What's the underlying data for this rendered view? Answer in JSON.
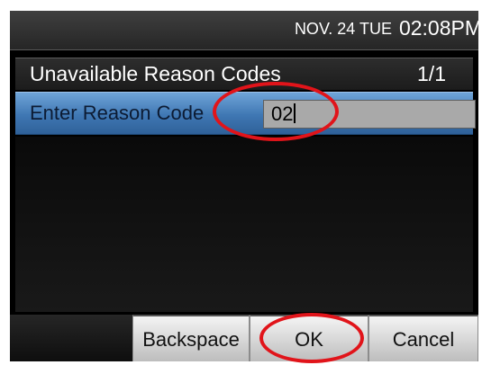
{
  "status_bar": {
    "date": "NOV. 24 TUE",
    "time": "02:08PM"
  },
  "title_row": {
    "title": "Unavailable Reason Codes",
    "page_indicator": "1/1"
  },
  "input_row": {
    "label": "Enter Reason Code",
    "value": "02"
  },
  "softkeys": {
    "backspace": "Backspace",
    "ok": "OK",
    "cancel": "Cancel"
  },
  "colors": {
    "highlight_blue": "#3f77b3",
    "annotation_red": "#e1141a"
  }
}
